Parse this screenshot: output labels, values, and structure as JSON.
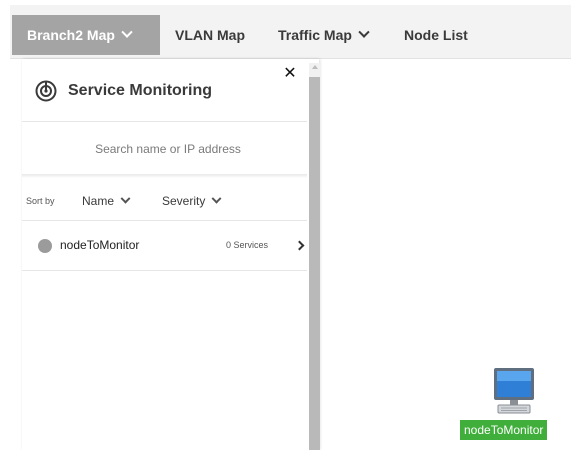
{
  "tabs": [
    {
      "label": "Branch2 Map",
      "has_dropdown": true,
      "active": true
    },
    {
      "label": "VLAN Map",
      "has_dropdown": false,
      "active": false
    },
    {
      "label": "Traffic Map",
      "has_dropdown": true,
      "active": false
    },
    {
      "label": "Node List",
      "has_dropdown": false,
      "active": false
    }
  ],
  "panel": {
    "title": "Service Monitoring",
    "title_icon": "service-monitoring-icon",
    "close_icon": "close-icon",
    "search": {
      "placeholder": "Search name or IP address",
      "value": ""
    },
    "sort": {
      "label": "Sort by",
      "name_option": "Name",
      "severity_option": "Severity"
    },
    "nodes": [
      {
        "name": "nodeToMonitor",
        "services": "0 Services",
        "status_color": "#9b9b9b"
      }
    ]
  },
  "map": {
    "nodes": [
      {
        "label": "nodeToMonitor",
        "icon": "computer-icon",
        "label_color": "#3fae3a"
      }
    ]
  },
  "colors": {
    "active_tab": "#a4a4a4",
    "node_label_bg": "#3fae3a"
  }
}
